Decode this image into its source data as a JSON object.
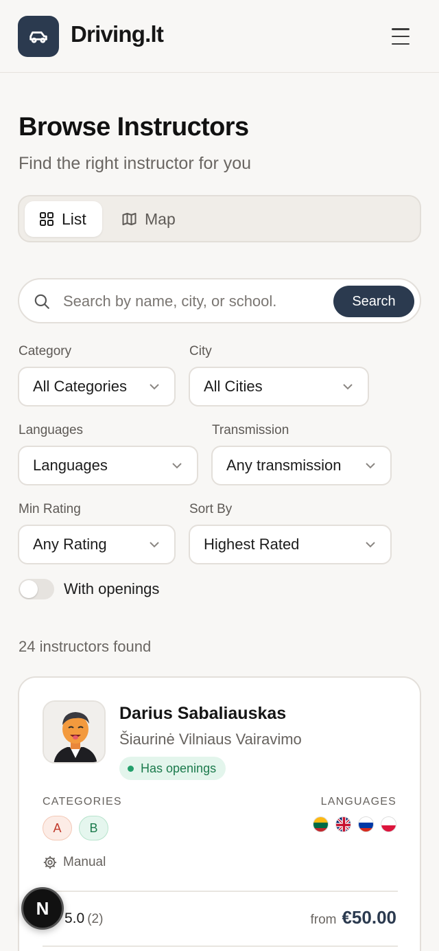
{
  "header": {
    "brand": "Driving.lt",
    "logo_icon": "car-icon",
    "menu_icon": "hamburger-menu-icon"
  },
  "page": {
    "title": "Browse Instructors",
    "subtitle": "Find the right instructor for you"
  },
  "view_toggle": {
    "list_label": "List",
    "list_icon": "grid-icon",
    "map_label": "Map",
    "map_icon": "map-icon",
    "active": "List"
  },
  "search": {
    "placeholder": "Search by name, city, or school.",
    "value": "",
    "button_label": "Search"
  },
  "filters": {
    "category": {
      "label": "Category",
      "value": "All Categories"
    },
    "city": {
      "label": "City",
      "value": "All Cities"
    },
    "languages": {
      "label": "Languages",
      "value": "Languages"
    },
    "transmission": {
      "label": "Transmission",
      "value": "Any transmission"
    },
    "min_rating": {
      "label": "Min Rating",
      "value": "Any Rating"
    },
    "sort_by": {
      "label": "Sort By",
      "value": "Highest Rated"
    },
    "with_openings": {
      "label": "With openings",
      "checked": false
    }
  },
  "results": {
    "count_text": "24 instructors found"
  },
  "instructors": [
    {
      "name": "Darius Sabaliauskas",
      "school": "Šiaurinė Vilniaus Vairavimo",
      "badge": "Has openings",
      "categories_label": "CATEGORIES",
      "categories": [
        "A",
        "B"
      ],
      "languages_label": "LANGUAGES",
      "languages": [
        "lithuanian-flag-icon",
        "uk-flag-icon",
        "russian-flag-icon",
        "polish-flag-icon"
      ],
      "transmission": "Manual",
      "rating": "5.0",
      "reviews": "(2)",
      "price_prefix": "from",
      "price": "€50.00"
    }
  ],
  "dev_badge": {
    "label": "N"
  },
  "colors": {
    "primary": "#2b3a4f",
    "background": "#f8f7f5",
    "success": "#22a06b"
  }
}
